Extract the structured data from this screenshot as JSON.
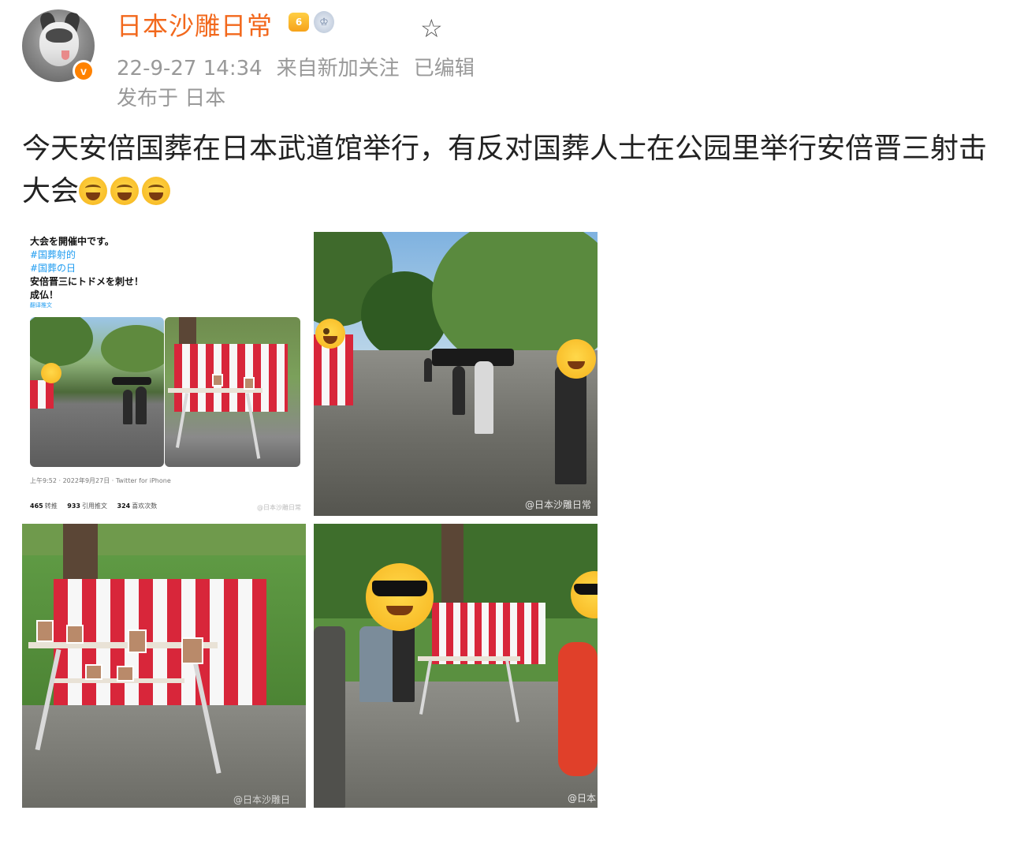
{
  "user": {
    "name": "日本沙雕日常",
    "verify_mark": "v",
    "member_badge": "6",
    "medal_mark": "♔"
  },
  "post": {
    "time": "22-9-27 14:34",
    "source": "来自新加关注",
    "edited": "已编辑",
    "location": "发布于 日本",
    "text": "今天安倍国葬在日本武道馆举行，有反对国葬人士在公园里举行安倍晋三射击大会",
    "emoji_count": 3
  },
  "tweet": {
    "line1": "大会を開催中です。",
    "tag1": "#国葬射的",
    "tag2": "#国葬の日",
    "line2": "安倍晋三にトドメを刺せ！",
    "line3": "成仏！",
    "translate": "翻译推文",
    "footer": "上午9:52 · 2022年9月27日 · Twitter for iPhone",
    "retweets_count": "465",
    "retweets_label": "转推",
    "quotes_count": "933",
    "quotes_label": "引用推文",
    "likes_count": "324",
    "likes_label": "喜欢次数",
    "watermark": "@日本沙雕日常"
  },
  "photos": {
    "watermark2": "@日本沙雕日常",
    "watermark3": "@日本沙雕日",
    "watermark4": "@日本"
  },
  "colors": {
    "username": "#f2681c",
    "meta": "#999999",
    "verify": "#ff8200",
    "link": "#1d9bf0"
  }
}
